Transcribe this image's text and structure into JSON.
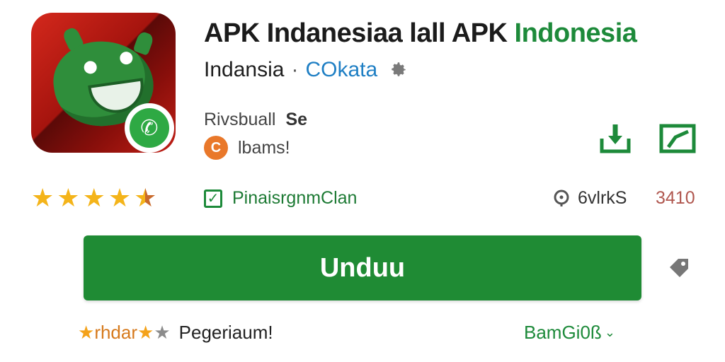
{
  "app": {
    "title_part1": "APK Indanesiaa lall APK ",
    "title_part2": "Indonesia",
    "developer": "Indansia",
    "separator": "·",
    "category_link": "COkata",
    "meta_line1": "Rivsbuall",
    "meta_line1_suffix": "Se",
    "meta_line2": "lbams!",
    "orange_badge": "C"
  },
  "rating": {
    "stars_full": 4,
    "stars_partial": 1,
    "check_label": "PinaisrgnmClan",
    "views_label": "6vlrkS",
    "count": "3410"
  },
  "download": {
    "button_label": "Unduu"
  },
  "footer": {
    "star_text": "rhdar",
    "left_label": "Pegeriaum!",
    "right_label": "BamGi0ß",
    "right_chevron": "⌄"
  },
  "icons": {
    "check_mark": "✓",
    "whatsapp": "✆",
    "star": "★"
  },
  "colors": {
    "accent_green": "#1f8b34",
    "link_blue": "#1f7fc4",
    "star_gold": "#f4b41a",
    "icon_red": "#c11f16"
  }
}
